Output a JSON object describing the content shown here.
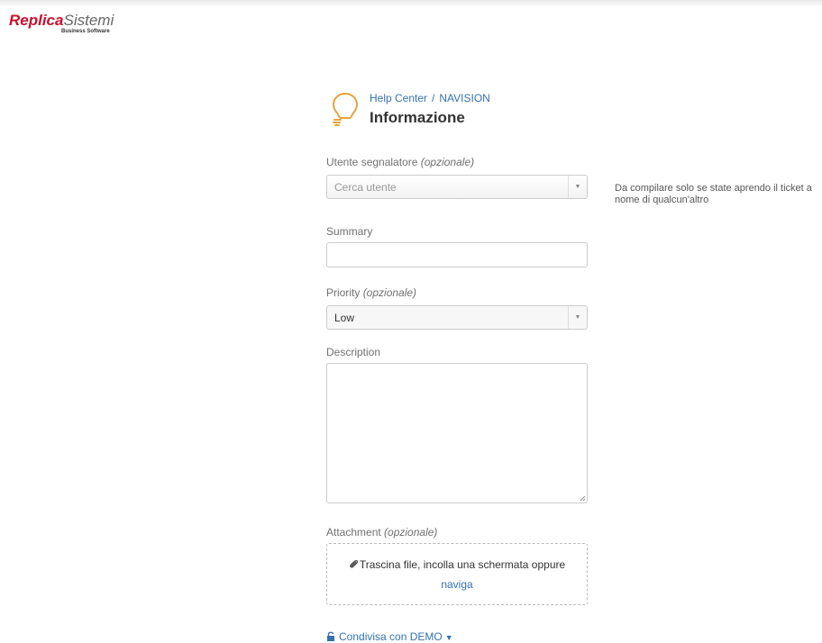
{
  "logo": {
    "brand_bold": "Replica",
    "brand_light": "Sistemi",
    "tagline": "Business Software"
  },
  "header": {
    "breadcrumb": [
      "Help Center",
      "NAVISION"
    ],
    "breadcrumb_separator": "/",
    "title": "Informazione",
    "icon": "lightbulb-icon"
  },
  "form": {
    "reporter": {
      "label": "Utente segnalatore",
      "optional": "(opzionale)",
      "placeholder": "Cerca utente",
      "help": "Da compilare solo se state aprendo il ticket a nome di qualcun'altro"
    },
    "summary": {
      "label": "Summary",
      "value": ""
    },
    "priority": {
      "label": "Priority",
      "optional": "(opzionale)",
      "selected": "Low"
    },
    "description": {
      "label": "Description",
      "value": ""
    },
    "attachment": {
      "label": "Attachment",
      "optional": "(opzionale)",
      "drop_text": "Trascina file, incolla una schermata oppure",
      "browse_link": "naviga"
    },
    "share": {
      "label": "Condivisa con DEMO"
    }
  },
  "colors": {
    "brand_red": "#c8102e",
    "link_blue": "#3572b0",
    "icon_orange": "#e8a33d"
  }
}
